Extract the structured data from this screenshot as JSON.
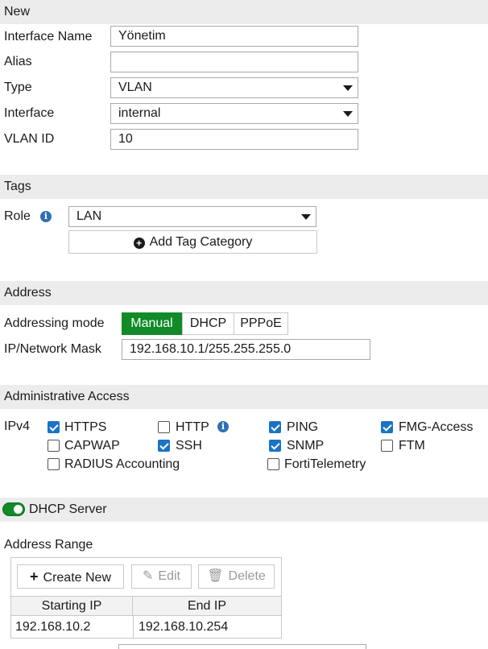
{
  "new_section": {
    "header": "New",
    "interface_name": {
      "label": "Interface Name",
      "value": "Yönetim"
    },
    "alias": {
      "label": "Alias",
      "value": ""
    },
    "type": {
      "label": "Type",
      "value": "VLAN"
    },
    "interface": {
      "label": "Interface",
      "value": "internal"
    },
    "vlan_id": {
      "label": "VLAN ID",
      "value": "10"
    }
  },
  "tags_section": {
    "header": "Tags",
    "role": {
      "label": "Role",
      "value": "LAN"
    },
    "add_tag_category": "Add Tag Category"
  },
  "address_section": {
    "header": "Address",
    "addressing_mode": {
      "label": "Addressing mode",
      "options": [
        "Manual",
        "DHCP",
        "PPPoE"
      ],
      "selected": "Manual"
    },
    "ip_mask": {
      "label": "IP/Network Mask",
      "value": "192.168.10.1/255.255.255.0"
    }
  },
  "admin_access": {
    "header": "Administrative Access",
    "ipv4_label": "IPv4",
    "options": [
      {
        "label": "HTTPS",
        "checked": true
      },
      {
        "label": "HTTP",
        "checked": false
      },
      {
        "label": "PING",
        "checked": true
      },
      {
        "label": "FMG-Access",
        "checked": true
      },
      {
        "label": "CAPWAP",
        "checked": false
      },
      {
        "label": "SSH",
        "checked": true
      },
      {
        "label": "SNMP",
        "checked": true
      },
      {
        "label": "FTM",
        "checked": false
      },
      {
        "label": "RADIUS Accounting",
        "checked": false
      },
      {
        "label": "FortiTelemetry",
        "checked": false
      }
    ]
  },
  "dhcp_server": {
    "label": "DHCP Server",
    "enabled": true,
    "address_range_label": "Address Range",
    "toolbar": {
      "create_new": "Create New",
      "edit": "Edit",
      "delete": "Delete"
    },
    "columns": [
      "Starting IP",
      "End IP"
    ],
    "rows": [
      [
        "192.168.10.2",
        "192.168.10.254"
      ]
    ]
  },
  "colors": {
    "accent_green": "#118a27",
    "checkbox_blue": "#1a73c6",
    "info_blue": "#2f6fb6"
  }
}
